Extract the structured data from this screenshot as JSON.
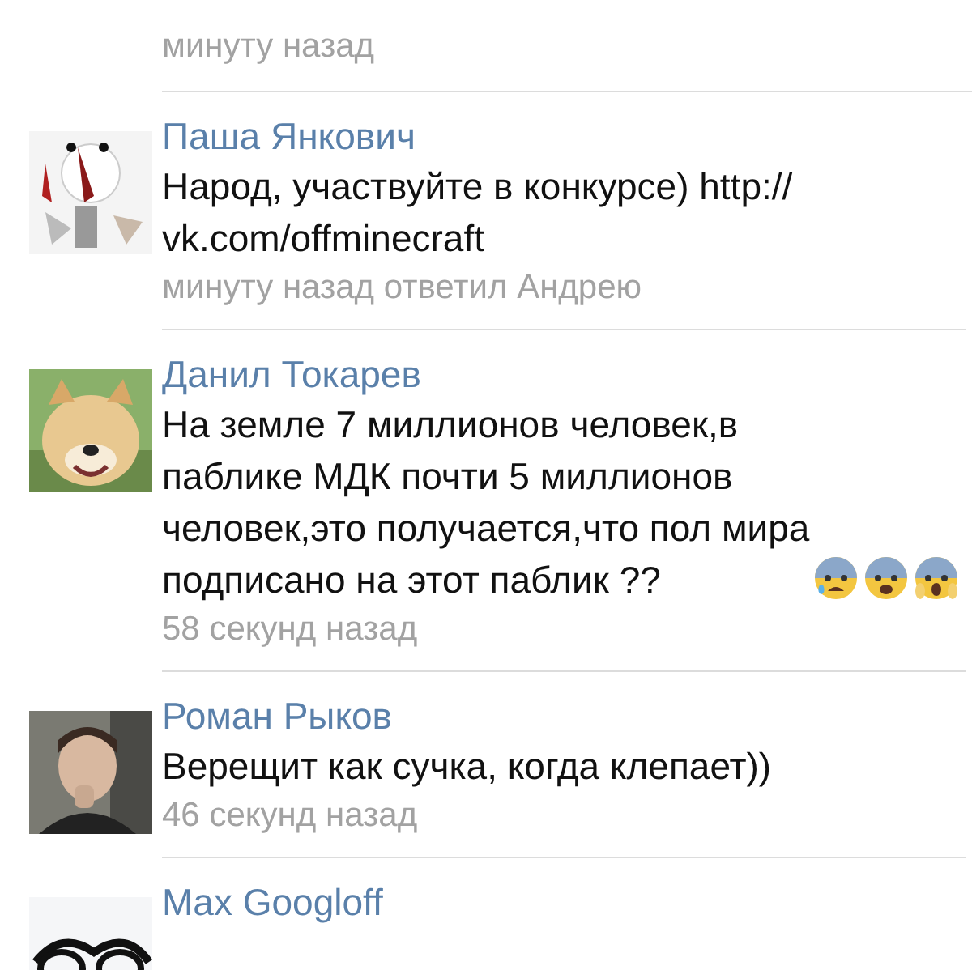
{
  "header_time": "минуту назад",
  "comments": [
    {
      "author": "Паша Янкович",
      "text": "Народ, участвуйте в конкурсе) http://\nvk.com/offminecraft",
      "time": "минуту назад ответил Андрею"
    },
    {
      "author": "Данил Токарев",
      "text": "На земле 7 миллионов человек,в\nпаблике МДК почти 5 миллионов\nчеловек,это получается,что пол мира\nподписано на этот паблик ??",
      "time": "58 секунд назад",
      "emojis": [
        {
          "kind": "sweating"
        },
        {
          "kind": "frightened"
        },
        {
          "kind": "screaming"
        }
      ]
    },
    {
      "author": "Роман Рыков",
      "text": "Верещит как сучка, когда клепает))",
      "time": "46 секунд назад"
    },
    {
      "author": "Max Googloff"
    }
  ]
}
